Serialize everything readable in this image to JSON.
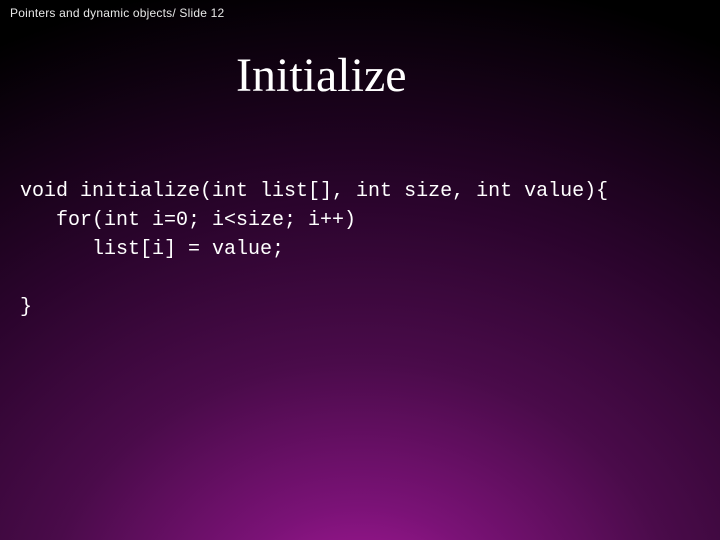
{
  "header": "Pointers and dynamic objects/ Slide 12",
  "title": "Initialize",
  "code": {
    "l1": "void initialize(int list[], int size, int value){",
    "l2": "   for(int i=0; i<size; i++)",
    "l3": "      list[i] = value;",
    "l4": "",
    "l5": "}"
  }
}
